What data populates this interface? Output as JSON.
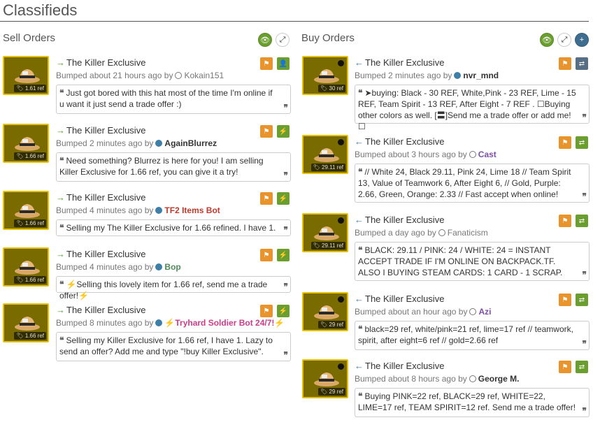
{
  "page_title": "Classifieds",
  "sell": {
    "heading": "Sell Orders",
    "listings": [
      {
        "item": "The Killer Exclusive",
        "bumped": "Bumped about 21 hours ago by",
        "user": "Kokain151",
        "user_style": "u-grey",
        "indicator": "ring",
        "price": "1.61 ref",
        "text": "Just got bored with this hat most of the time I'm online if u want it just send a trade offer :)",
        "action": "add-friend"
      },
      {
        "item": "The Killer Exclusive",
        "bumped": "Bumped 2 minutes ago by",
        "user": "AgainBlurrez",
        "user_style": "u-plain",
        "indicator": "dot",
        "price": "1.66 ref",
        "text": "Need something? Blurrez is here for you! I am selling Killer Exclusive for 1.66 ref, you can give it a try!",
        "action": "trade"
      },
      {
        "item": "The Killer Exclusive",
        "bumped": "Bumped 4 minutes ago by",
        "user": "TF2 Items Bot",
        "user_style": "u-red",
        "indicator": "dot",
        "price": "1.66 ref",
        "text": "Selling my The Killer Exclusive for 1.66 refined. I have 1.",
        "action": "trade"
      },
      {
        "item": "The Killer Exclusive",
        "bumped": "Bumped 4 minutes ago by",
        "user": "Bop",
        "user_style": "u-green",
        "indicator": "dot",
        "price": "1.66 ref",
        "text": "⚡Selling this lovely item for 1.66 ref, send me a trade offer!⚡",
        "action": "trade"
      },
      {
        "item": "The Killer Exclusive",
        "bumped": "Bumped 8 minutes ago by",
        "user": "⚡Tryhard Soldier Bot 24/7!⚡",
        "user_style": "u-pink",
        "indicator": "dot",
        "price": "1.66 ref",
        "text": "Selling my Killer Exclusive for 1.66 ref, I have 1. Lazy to send an offer? Add me and type \"!buy Killer Exclusive\".",
        "action": "trade"
      }
    ]
  },
  "buy": {
    "heading": "Buy Orders",
    "listings": [
      {
        "item": "The Killer Exclusive",
        "bumped": "Bumped 2 minutes ago by",
        "user": "nvr_mnd",
        "user_style": "u-plain",
        "indicator": "dot",
        "price": "30 ref",
        "text": "➤buying: Black - 30 REF, White,Pink - 23 REF, Lime - 15 REF, Team Spirit - 13 REF, After Eight - 7 REF . ☐Buying other colors as well. [〓]Send me a trade offer or add me!☐",
        "action": "trade-blue"
      },
      {
        "item": "The Killer Exclusive",
        "bumped": "Bumped about 3 hours ago by",
        "user": "Cast",
        "user_style": "u-purple",
        "indicator": "ring",
        "price": "29.11 ref",
        "text": "// White 24, Black 29.11, Pink 24, Lime 18 // Team Spirit 13, Value of Teamwork 6, After Eight 6, // Gold, Purple: 2.66, Green, Orange: 2.33 // Fast accept when online!",
        "action": "trade"
      },
      {
        "item": "The Killer Exclusive",
        "bumped": "Bumped a day ago by",
        "user": "Fanaticism",
        "user_style": "u-grey",
        "indicator": "ring",
        "price": "29.11 ref",
        "text": "BLACK: 29.11 / PINK: 24 / WHITE: 24 = INSTANT ACCEPT TRADE IF I'M ONLINE ON BACKPACK.TF. ALSO I BUYING STEAM CARDS: 1 CARD - 1 SCRAP.",
        "action": "trade"
      },
      {
        "item": "The Killer Exclusive",
        "bumped": "Bumped about an hour ago by",
        "user": "Azi",
        "user_style": "u-purple",
        "indicator": "ring",
        "price": "29 ref",
        "text": "black=29 ref, white/pink=21 ref, lime=17 ref // teamwork, spirit, after eight=6 ref // gold=2.66 ref",
        "action": "trade"
      },
      {
        "item": "The Killer Exclusive",
        "bumped": "Bumped about 8 hours ago by",
        "user": "George M.",
        "user_style": "u-plain",
        "indicator": "ring",
        "price": "29 ref",
        "text": "Buying PINK=22 ref, BLACK=29 ref, WHITE=22, LIME=17 ref, TEAM SPIRIT=12 ref. Send me a trade offer!",
        "action": "trade"
      }
    ]
  }
}
